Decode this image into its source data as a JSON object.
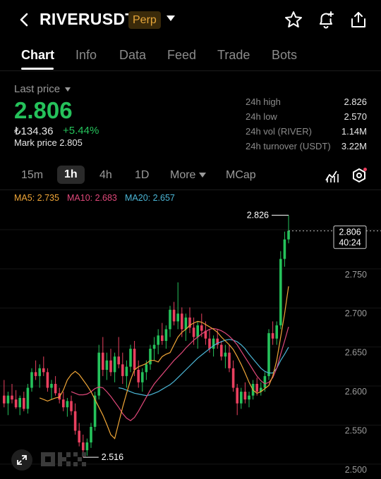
{
  "header": {
    "symbol": "RIVERUSDT",
    "badge": "Perp"
  },
  "tabs": [
    {
      "label": "Chart",
      "active": true
    },
    {
      "label": "Info"
    },
    {
      "label": "Data"
    },
    {
      "label": "Feed"
    },
    {
      "label": "Trade"
    },
    {
      "label": "Bots"
    }
  ],
  "ticker": {
    "last_label": "Last price",
    "last_price": "2.806",
    "fiat": "₺134.36",
    "change": "+5.44%",
    "mark_price": "Mark price 2.805"
  },
  "stats": [
    {
      "label": "24h high",
      "value": "2.826"
    },
    {
      "label": "24h low",
      "value": "2.570"
    },
    {
      "label": "24h vol (RIVER)",
      "value": "1.14M"
    },
    {
      "label": "24h turnover (USDT)",
      "value": "3.22M"
    }
  ],
  "intervals": [
    "15m",
    "1h",
    "4h",
    "1D",
    "More",
    "MCap"
  ],
  "selected_interval": "1h",
  "ma": [
    {
      "label": "MA5: 2.735",
      "color": "#f0a637"
    },
    {
      "label": "MA10: 2.683",
      "color": "#e0487a"
    },
    {
      "label": "MA20: 2.657",
      "color": "#4bb6d6"
    }
  ],
  "colors": {
    "up": "#25c25b",
    "down": "#e9405f",
    "accent": "#e6a63a"
  },
  "chart_data": {
    "type": "candlestick",
    "y_ticks": [
      "2.750",
      "2.700",
      "2.650",
      "2.600",
      "2.550",
      "2.500"
    ],
    "ylim": [
      2.49,
      2.84
    ],
    "high_label": "2.826",
    "low_label": "2.516",
    "current_price": "2.806",
    "countdown": "40:24",
    "ohlc": [
      [
        2.595,
        2.615,
        2.58,
        2.585
      ],
      [
        2.585,
        2.6,
        2.57,
        2.595
      ],
      [
        2.595,
        2.61,
        2.585,
        2.59
      ],
      [
        2.59,
        2.602,
        2.578,
        2.58
      ],
      [
        2.58,
        2.595,
        2.57,
        2.592
      ],
      [
        2.592,
        2.6,
        2.575,
        2.578
      ],
      [
        2.578,
        2.61,
        2.572,
        2.605
      ],
      [
        2.605,
        2.63,
        2.6,
        2.625
      ],
      [
        2.625,
        2.64,
        2.615,
        2.62
      ],
      [
        2.62,
        2.635,
        2.605,
        2.63
      ],
      [
        2.63,
        2.645,
        2.62,
        2.625
      ],
      [
        2.625,
        2.63,
        2.6,
        2.605
      ],
      [
        2.605,
        2.615,
        2.59,
        2.61
      ],
      [
        2.61,
        2.62,
        2.595,
        2.598
      ],
      [
        2.598,
        2.605,
        2.585,
        2.59
      ],
      [
        2.59,
        2.6,
        2.575,
        2.58
      ],
      [
        2.58,
        2.592,
        2.568,
        2.588
      ],
      [
        2.588,
        2.595,
        2.57,
        2.575
      ],
      [
        2.575,
        2.585,
        2.545,
        2.55
      ],
      [
        2.55,
        2.56,
        2.53,
        2.535
      ],
      [
        2.535,
        2.545,
        2.516,
        2.525
      ],
      [
        2.525,
        2.54,
        2.518,
        2.535
      ],
      [
        2.535,
        2.56,
        2.528,
        2.555
      ],
      [
        2.555,
        2.6,
        2.55,
        2.595
      ],
      [
        2.595,
        2.66,
        2.59,
        2.65
      ],
      [
        2.65,
        2.67,
        2.62,
        2.628
      ],
      [
        2.628,
        2.65,
        2.615,
        2.64
      ],
      [
        2.64,
        2.655,
        2.62,
        2.625
      ],
      [
        2.625,
        2.65,
        2.612,
        2.645
      ],
      [
        2.645,
        2.67,
        2.63,
        2.635
      ],
      [
        2.635,
        2.65,
        2.61,
        2.62
      ],
      [
        2.62,
        2.64,
        2.605,
        2.632
      ],
      [
        2.632,
        2.66,
        2.625,
        2.655
      ],
      [
        2.655,
        2.665,
        2.62,
        2.628
      ],
      [
        2.628,
        2.64,
        2.605,
        2.612
      ],
      [
        2.612,
        2.63,
        2.6,
        2.625
      ],
      [
        2.625,
        2.64,
        2.615,
        2.635
      ],
      [
        2.635,
        2.66,
        2.628,
        2.655
      ],
      [
        2.655,
        2.67,
        2.64,
        2.66
      ],
      [
        2.66,
        2.68,
        2.648,
        2.672
      ],
      [
        2.672,
        2.688,
        2.66,
        2.665
      ],
      [
        2.665,
        2.685,
        2.655,
        2.68
      ],
      [
        2.68,
        2.71,
        2.67,
        2.705
      ],
      [
        2.705,
        2.715,
        2.685,
        2.69
      ],
      [
        2.69,
        2.74,
        2.68,
        2.7
      ],
      [
        2.7,
        2.708,
        2.67,
        2.68
      ],
      [
        2.68,
        2.7,
        2.665,
        2.695
      ],
      [
        2.695,
        2.708,
        2.675,
        2.682
      ],
      [
        2.682,
        2.695,
        2.66,
        2.67
      ],
      [
        2.67,
        2.69,
        2.655,
        2.685
      ],
      [
        2.685,
        2.7,
        2.67,
        2.678
      ],
      [
        2.678,
        2.69,
        2.66,
        2.668
      ],
      [
        2.668,
        2.68,
        2.65,
        2.655
      ],
      [
        2.655,
        2.672,
        2.645,
        2.668
      ],
      [
        2.668,
        2.68,
        2.655,
        2.66
      ],
      [
        2.66,
        2.665,
        2.64,
        2.645
      ],
      [
        2.645,
        2.66,
        2.63,
        2.65
      ],
      [
        2.65,
        2.66,
        2.625,
        2.63
      ],
      [
        2.63,
        2.64,
        2.6,
        2.605
      ],
      [
        2.605,
        2.61,
        2.57,
        2.585
      ],
      [
        2.585,
        2.605,
        2.578,
        2.6
      ],
      [
        2.6,
        2.612,
        2.585,
        2.59
      ],
      [
        2.59,
        2.6,
        2.58,
        2.595
      ],
      [
        2.595,
        2.615,
        2.59,
        2.61
      ],
      [
        2.61,
        2.618,
        2.595,
        2.6
      ],
      [
        2.6,
        2.612,
        2.595,
        2.605
      ],
      [
        2.605,
        2.625,
        2.6,
        2.62
      ],
      [
        2.62,
        2.68,
        2.615,
        2.675
      ],
      [
        2.675,
        2.69,
        2.66,
        2.668
      ],
      [
        2.668,
        2.69,
        2.66,
        2.685
      ],
      [
        2.685,
        2.78,
        2.68,
        2.77
      ],
      [
        2.77,
        2.805,
        2.76,
        2.795
      ],
      [
        2.795,
        2.826,
        2.79,
        2.806
      ]
    ],
    "ma5": [
      2.592,
      2.59,
      2.588,
      2.59,
      2.592,
      2.593,
      2.602,
      2.615,
      2.622,
      2.626,
      2.622,
      2.615,
      2.608,
      2.6,
      2.59,
      2.58,
      2.57,
      2.558,
      2.545,
      2.54,
      2.56,
      2.58,
      2.598,
      2.615,
      2.628,
      2.632,
      2.634,
      2.636,
      2.64,
      2.64,
      2.638,
      2.645,
      2.648,
      2.65,
      2.66,
      2.67,
      2.676,
      2.68,
      2.685,
      2.688,
      2.69,
      2.689,
      2.686,
      2.683,
      2.68,
      2.676,
      2.67,
      2.665,
      2.66,
      2.654,
      2.645,
      2.635,
      2.624,
      2.612,
      2.602,
      2.598,
      2.6,
      2.604,
      2.608,
      2.62,
      2.64,
      2.67,
      2.7,
      2.735
    ],
    "ma10": [
      2.6,
      2.598,
      2.596,
      2.596,
      2.597,
      2.6,
      2.604,
      2.606,
      2.605,
      2.6,
      2.594,
      2.587,
      2.58,
      2.572,
      2.566,
      2.563,
      2.567,
      2.575,
      2.584,
      2.593,
      2.602,
      2.61,
      2.616,
      2.622,
      2.628,
      2.634,
      2.64,
      2.645,
      2.65,
      2.656,
      2.661,
      2.666,
      2.67,
      2.674,
      2.677,
      2.68,
      2.681,
      2.68,
      2.678,
      2.675,
      2.671,
      2.666,
      2.66,
      2.652,
      2.644,
      2.636,
      2.628,
      2.62,
      2.614,
      2.61,
      2.612,
      2.618,
      2.63,
      2.648,
      2.665,
      2.683
    ],
    "ma20": [
      2.605,
      2.604,
      2.602,
      2.6,
      2.598,
      2.597,
      2.596,
      2.595,
      2.596,
      2.598,
      2.6,
      2.603,
      2.606,
      2.609,
      2.613,
      2.618,
      2.623,
      2.628,
      2.633,
      2.638,
      2.643,
      2.647,
      2.651,
      2.655,
      2.659,
      2.662,
      2.664,
      2.666,
      2.667,
      2.666,
      2.664,
      2.66,
      2.655,
      2.648,
      2.642,
      2.636,
      2.63,
      2.626,
      2.624,
      2.624,
      2.63,
      2.64,
      2.648,
      2.657
    ]
  }
}
